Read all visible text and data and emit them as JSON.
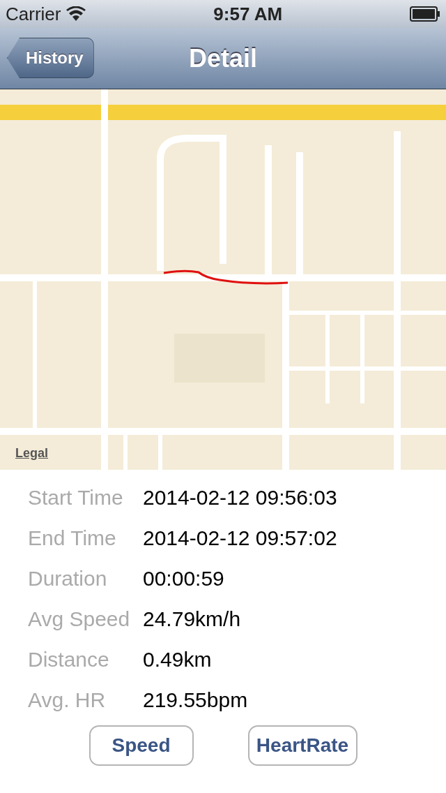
{
  "status_bar": {
    "carrier": "Carrier",
    "time": "9:57 AM"
  },
  "nav": {
    "back": "History",
    "title": "Detail"
  },
  "map": {
    "legal": "Legal"
  },
  "details": [
    {
      "label": "Start Time",
      "value": "2014-02-12 09:56:03"
    },
    {
      "label": "End Time",
      "value": "2014-02-12 09:57:02"
    },
    {
      "label": "Duration",
      "value": "00:00:59"
    },
    {
      "label": "Avg Speed",
      "value": "24.79km/h"
    },
    {
      "label": "Distance",
      "value": "0.49km"
    },
    {
      "label": "Avg. HR",
      "value": "219.55bpm"
    }
  ],
  "buttons": [
    "Speed",
    "HeartRate"
  ]
}
